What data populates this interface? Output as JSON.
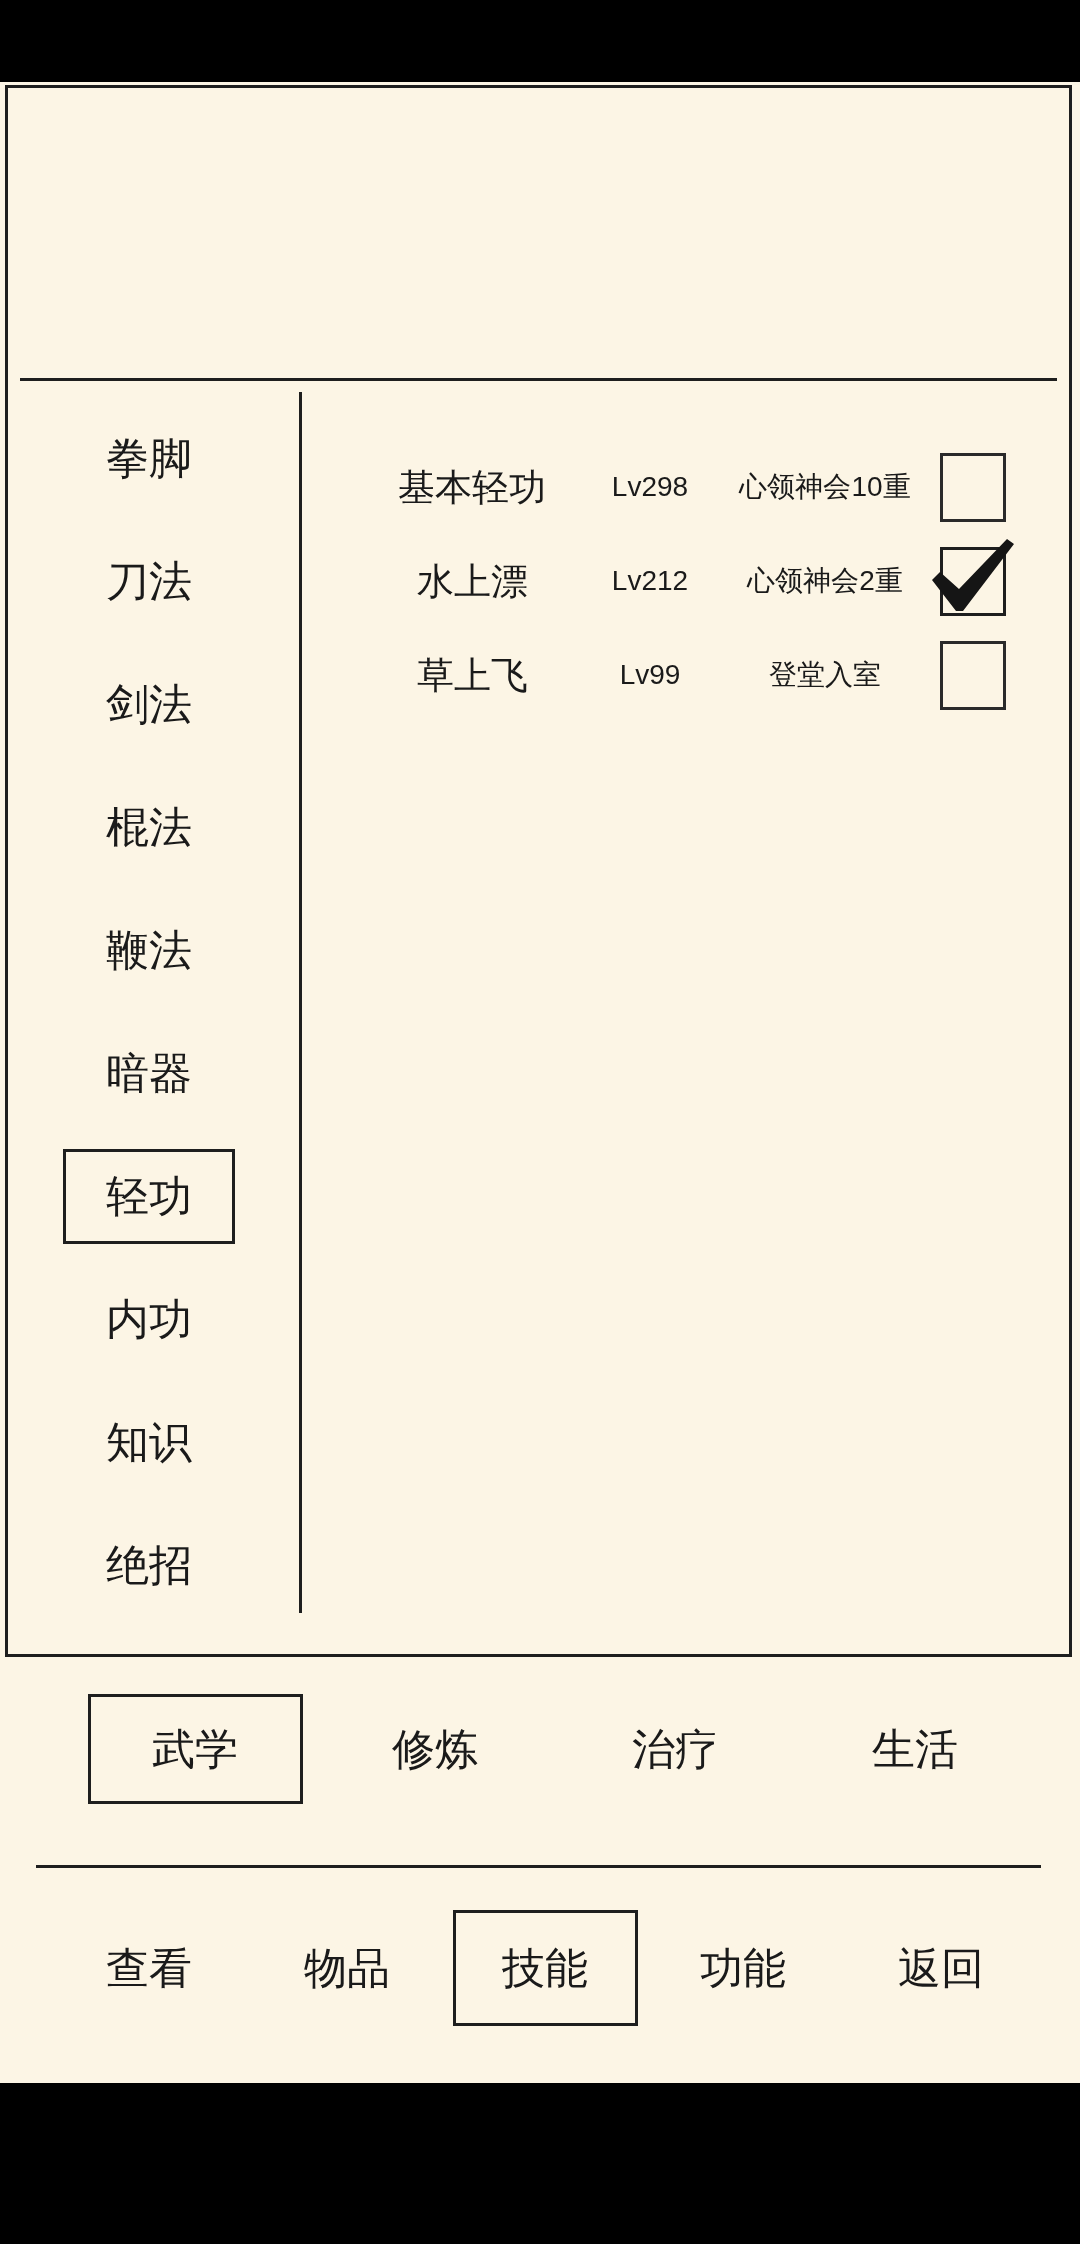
{
  "categories": [
    {
      "label": "拳脚",
      "selected": false
    },
    {
      "label": "刀法",
      "selected": false
    },
    {
      "label": "剑法",
      "selected": false
    },
    {
      "label": "棍法",
      "selected": false
    },
    {
      "label": "鞭法",
      "selected": false
    },
    {
      "label": "暗器",
      "selected": false
    },
    {
      "label": "轻功",
      "selected": true
    },
    {
      "label": "内功",
      "selected": false
    },
    {
      "label": "知识",
      "selected": false
    },
    {
      "label": "绝招",
      "selected": false
    }
  ],
  "skills": [
    {
      "name": "基本轻功",
      "lv": "Lv298",
      "realm": "心领神会10重",
      "checked": false
    },
    {
      "name": "水上漂",
      "lv": "Lv212",
      "realm": "心领神会2重",
      "checked": true
    },
    {
      "name": "草上飞",
      "lv": "Lv99",
      "realm": "登堂入室",
      "checked": false
    }
  ],
  "section_tabs": [
    {
      "label": "武学",
      "selected": true
    },
    {
      "label": "修炼",
      "selected": false
    },
    {
      "label": "治疗",
      "selected": false
    },
    {
      "label": "生活",
      "selected": false
    }
  ],
  "bottom_nav": [
    {
      "label": "查看",
      "selected": false
    },
    {
      "label": "物品",
      "selected": false
    },
    {
      "label": "技能",
      "selected": true
    },
    {
      "label": "功能",
      "selected": false
    },
    {
      "label": "返回",
      "selected": false
    }
  ]
}
